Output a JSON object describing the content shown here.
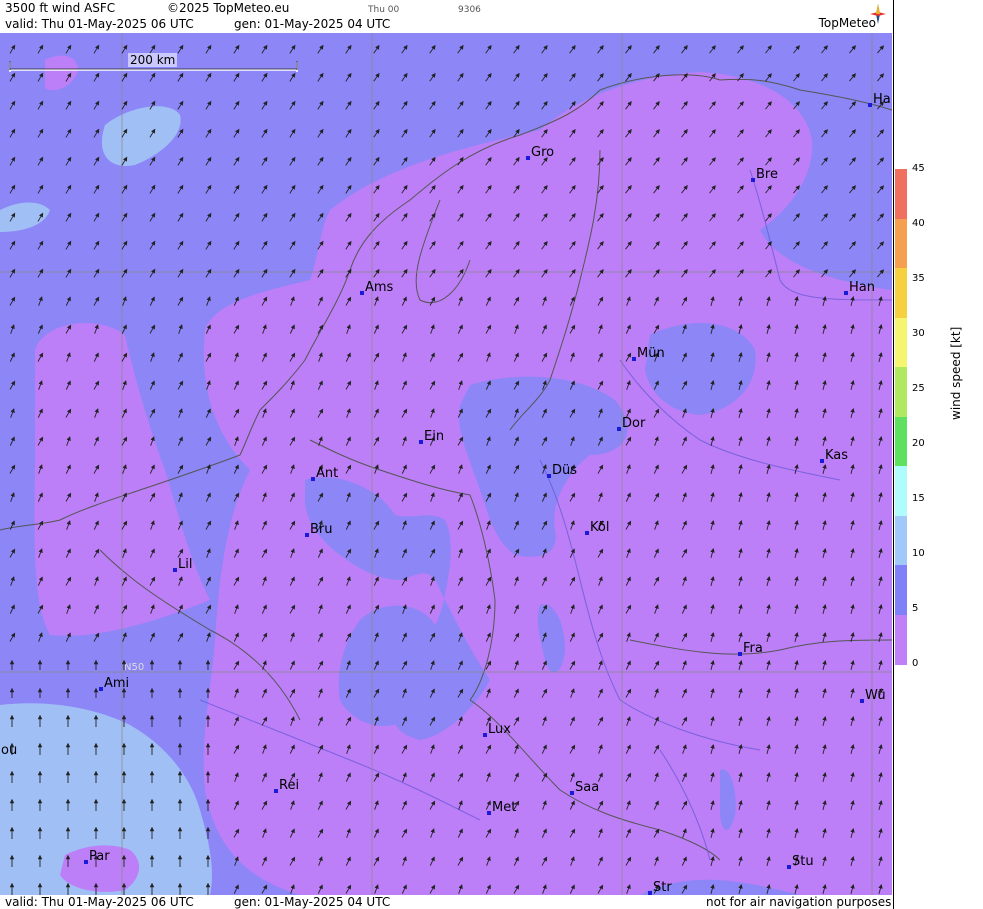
{
  "header": {
    "product": "3500 ft wind ASFC",
    "copyright": "©2025 TopMeteo.eu",
    "thu": "Thu 00",
    "code": "9306",
    "valid": "valid:  Thu  01-May-2025  06 UTC",
    "gen": "gen: 01-May-2025 04 UTC",
    "logo": "TopMeteo"
  },
  "footer": {
    "valid": "valid:  Thu  01-May-2025  06 UTC",
    "gen": "gen: 01-May-2025 04 UTC",
    "disclaimer": "not for air navigation purposes"
  },
  "scale_bar": {
    "label": "200 km"
  },
  "grid_label": "N50",
  "legend": {
    "unit": "wind  speed  [kt]",
    "ticks": [
      "45",
      "40",
      "35",
      "30",
      "25",
      "20",
      "15",
      "10",
      "5",
      "0"
    ],
    "colors": [
      "#f07060",
      "#f5a050",
      "#f5d040",
      "#f5f570",
      "#b0e860",
      "#60e060",
      "#b0fcfc",
      "#a0c8f8",
      "#8080f8",
      "#c080f8"
    ]
  },
  "map": {
    "cities": [
      "Gro",
      "Bre",
      "Ha",
      "Ams",
      "Han",
      "Mün",
      "Dor",
      "Ein",
      "Kas",
      "Düs",
      "Ant",
      "Köl",
      "Bru",
      "Lil",
      "Fra",
      "Ami",
      "Wü",
      "Lux",
      "ou",
      "Rei",
      "Saa",
      "Met",
      "Par",
      "Stu",
      "Str"
    ]
  }
}
